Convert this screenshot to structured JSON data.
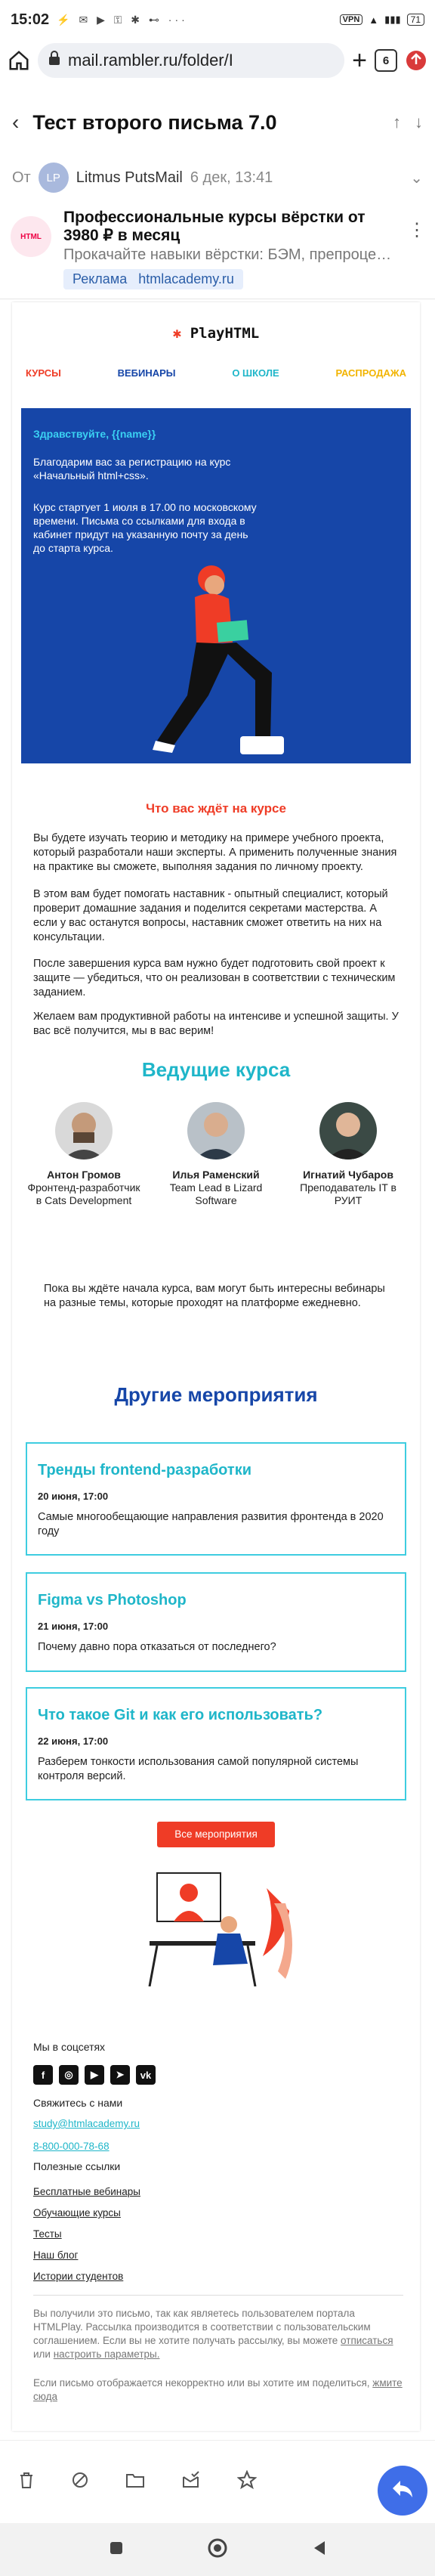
{
  "status": {
    "time": "15:02",
    "icons": "⚡ ✉ ▶ ⚿ ✱ ⊷ ···",
    "right_chip": "VPN",
    "battery": "71"
  },
  "browser": {
    "url": "mail.rambler.ru/folder/I",
    "tabs": "6"
  },
  "mail": {
    "subject": "Тест второго письма 7.0",
    "from_label": "От",
    "sender_initials": "LP",
    "sender_name": "Litmus PutsMail",
    "date": "6 дек, 13:41"
  },
  "ad": {
    "title": "Профессиональные курсы вёрстки от 3980 ₽ в месяц",
    "subtitle": "Прокачайте навыки вёрстки: БЭМ, препроце…",
    "tag": "Реклама",
    "domain": "htmlacademy.ru"
  },
  "letter": {
    "logo": "PlayHTML",
    "nav": [
      "КУРСЫ",
      "ВЕБИНАРЫ",
      "О ШКОЛЕ",
      "РАСПРОДАЖА"
    ],
    "nav_colors": [
      "#ef3c26",
      "#1646a8",
      "#1fb6c9",
      "#f2b400"
    ],
    "greeting": "Здравствуйте, {{name}}",
    "hero_p1": "Благодарим вас за регистрацию на курс «Начальный html+css».",
    "hero_p2": "Курс стартует 1 июля в 17.00 по московскому времени. Письма со ссылками для входа в кабинет придут на указанную почту за день до старта курса.",
    "what_title": "Что вас ждёт на курсе",
    "what_p1": "Вы будете изучать теорию и методику на примере учебного проекта, который разработали наши эксперты. А применить полученные знания на практике вы сможете, выполняя задания по личному проекту.",
    "what_p2": "В этом вам будет помогать наставник - опытный специалист, который проверит домашние задания и поделится секретами мастерства. А если у вас останутся вопросы, наставник сможет ответить на них на консультации.",
    "what_p3": "После завершения курса вам нужно будет подготовить свой проект к защите — убедиться, что он реализован в соответствии с техническим заданием.",
    "what_p4": "Желаем вам продуктивной работы на интенсиве и успешной защиты. У вас всё получится, мы в вас верим!",
    "teachers_title": "Ведущие курса",
    "teachers": [
      {
        "name": "Антон Громов",
        "role": "Фронтенд-разработчик в Cats Development"
      },
      {
        "name": "Илья Раменский",
        "role": "Team Lead в Lizard Software"
      },
      {
        "name": "Игнатий Чубаров",
        "role": "Преподаватель IT в РУИТ"
      }
    ],
    "waiting_text": "Пока вы ждёте начала курса, вам могут быть интересны вебинары на разные темы, которые проходят на платформе ежедневно.",
    "events_title": "Другие мероприятия",
    "events": [
      {
        "title": "Тренды frontend-разработки",
        "date": "20 июня, 17:00",
        "text": "Самые многообещающие направления развития фронтенда в 2020 году"
      },
      {
        "title": "Figma vs Photoshop",
        "date": "21 июня, 17:00",
        "text": "Почему давно пора отказаться от последнего?"
      },
      {
        "title": "Что такое Git и как его использовать?",
        "date": "22 июня, 17:00",
        "text": "Разберем тонкости использования самой популярной системы контроля версий."
      }
    ],
    "all_events_button": "Все мероприятия",
    "footer": {
      "social_label": "Мы в соцсетях",
      "contact_label": "Свяжитесь с нами",
      "email": "study@htmlacademy.ru",
      "phone": "8-800-000-78-68",
      "links_label": "Полезные ссылки",
      "links": [
        "Бесплатные вебинары",
        "Обучающие курсы",
        "Тесты",
        "Наш блог",
        "Истории студентов"
      ],
      "notice1_a": "Вы получили это письмо, так как являетесь пользователем портала HTMLPlay. Рассылка производится в соответствии с пользовательским соглашением. Если вы не хотите получать рассылку, вы можете ",
      "unsubscribe": "отписаться",
      "notice1_b": " или ",
      "settings": "настроить параметры.",
      "notice2_a": "Если письмо отображается некорректно или вы хотите им поделиться, ",
      "web_link": "жмите сюда"
    }
  },
  "colors": {
    "accent_red": "#ef3c26",
    "brand_blue": "#1646a8",
    "cyan": "#1fb6c9",
    "reply_blue": "#3f6ee8"
  }
}
